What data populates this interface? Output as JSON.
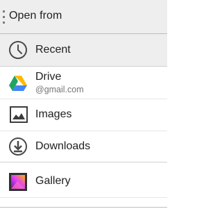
{
  "header": {
    "title": "Open from"
  },
  "roots": {
    "recent": {
      "label": "Recent",
      "icon": "clock-icon"
    },
    "drive": {
      "label": "Drive",
      "summary": "@gmail.com",
      "icon": "google-drive-icon"
    },
    "images": {
      "label": "Images",
      "icon": "image-icon"
    },
    "downloads": {
      "label": "Downloads",
      "icon": "download-icon"
    },
    "gallery": {
      "label": "Gallery",
      "icon": "gallery-icon"
    }
  },
  "colors": {
    "header_bg": "#eeeeee",
    "selected_bg": "#eeeeee",
    "text": "#212121",
    "subtext": "#757575"
  }
}
